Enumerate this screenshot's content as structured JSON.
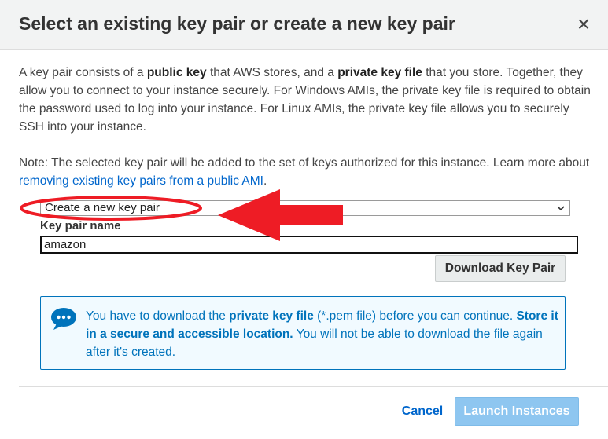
{
  "dialog": {
    "title": "Select an existing key pair or create a new key pair",
    "close_label": "×"
  },
  "intro": {
    "t1": "A key pair consists of a ",
    "b1": "public key",
    "t2": " that AWS stores, and a ",
    "b2": "private key file",
    "t3": " that you store. Together, they allow you to connect to your instance securely. For Windows AMIs, the private key file is required to obtain the password used to log into your instance. For Linux AMIs, the private key file allows you to securely SSH into your instance."
  },
  "note": {
    "text": "Note: The selected key pair will be added to the set of keys authorized for this instance. Learn more about",
    "link": "removing existing key pairs from a public AMI",
    "end": "."
  },
  "key_pair_select": {
    "selected": "Create a new key pair"
  },
  "key_pair_name": {
    "label": "Key pair name",
    "value": "amazon"
  },
  "download_button": "Download Key Pair",
  "info": {
    "t1": "You have to download the ",
    "b1": "private key file",
    "t2": " (*.pem file) before you can continue. ",
    "b2": "Store it in a secure and accessible location.",
    "t3": " You will not be able to download the file again after it's created."
  },
  "footer": {
    "cancel": "Cancel",
    "launch": "Launch Instances"
  },
  "colors": {
    "accent": "#0073bb",
    "link": "#0066cc",
    "annotation": "#ee1c25",
    "launch_disabled": "#8ec6f0"
  }
}
